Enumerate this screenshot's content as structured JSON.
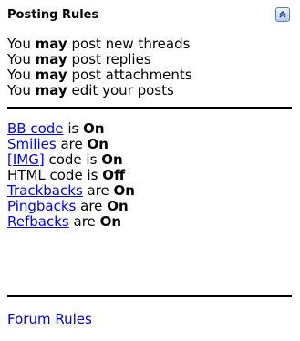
{
  "header": {
    "title": "Posting Rules"
  },
  "permissions": [
    {
      "pre": "You",
      "strong": "may",
      "post": "post new threads"
    },
    {
      "pre": "You",
      "strong": "may",
      "post": "post replies"
    },
    {
      "pre": "You",
      "strong": "may",
      "post": "post attachments"
    },
    {
      "pre": "You",
      "strong": "may",
      "post": "edit your posts"
    }
  ],
  "codes": [
    {
      "label": "BB code",
      "verb": "is",
      "status": "On"
    },
    {
      "label": "Smilies",
      "verb": "are",
      "status": "On"
    },
    {
      "label": "[IMG]",
      "verb": "code is",
      "status": "On"
    },
    {
      "label": "HTML code",
      "verb": "is",
      "status": "Off"
    },
    {
      "label": "Trackbacks",
      "verb": "are",
      "status": "On"
    },
    {
      "label": "Pingbacks",
      "verb": "are",
      "status": "On"
    },
    {
      "label": "Refbacks",
      "verb": "are",
      "status": "On"
    }
  ],
  "footer": {
    "forum_rules": "Forum Rules"
  },
  "icons": {
    "collapse": "collapse-icon"
  }
}
